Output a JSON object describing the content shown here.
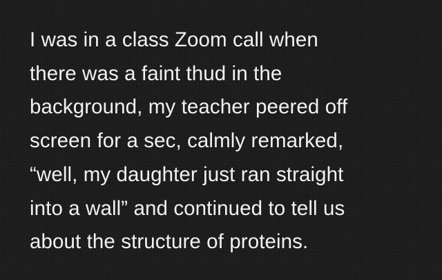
{
  "note": {
    "lines": [
      "I was in a class Zoom call when",
      "there was a faint thud in the",
      "background, my teacher peered off",
      "screen for a sec, calmly remarked,",
      "“well, my daughter just ran straight",
      "into a wall” and continued to tell us",
      "about the structure of proteins."
    ]
  }
}
